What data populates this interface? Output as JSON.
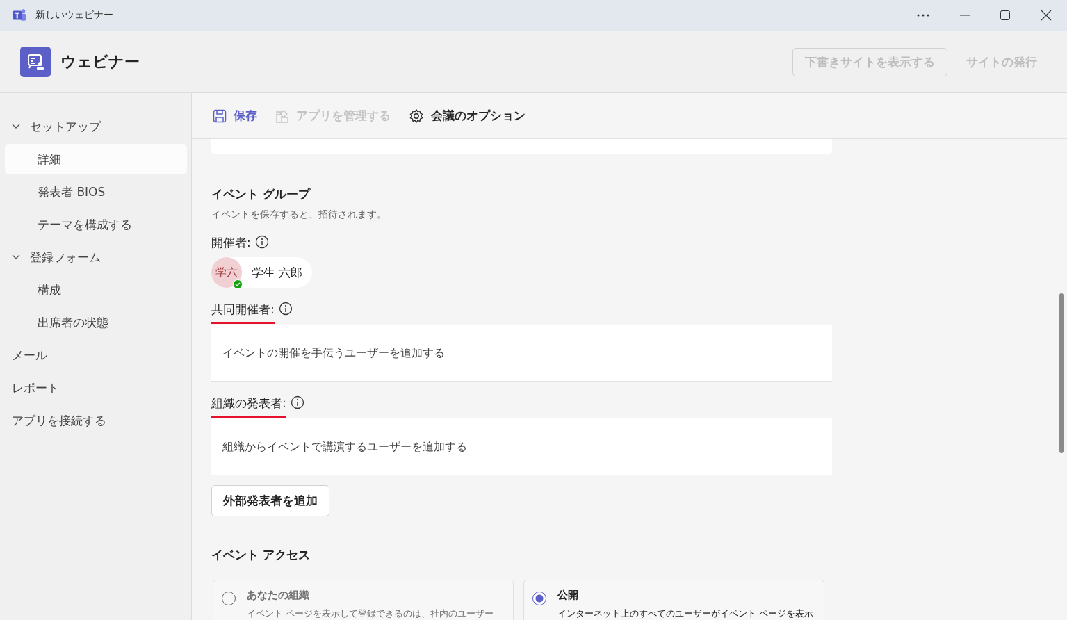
{
  "window": {
    "title": "新しいウェビナー"
  },
  "header": {
    "title": "ウェビナー",
    "buttons": [
      {
        "label": "下書きサイトを表示する",
        "kind": "outline",
        "disabled": true
      },
      {
        "label": "サイトの発行",
        "kind": "plain",
        "disabled": true
      }
    ]
  },
  "sidebar": {
    "items": [
      {
        "label": "セットアップ",
        "expanded": true,
        "selected": false,
        "children": [
          {
            "label": "詳細",
            "selected": true
          },
          {
            "label": "発表者 BIOS",
            "selected": false
          },
          {
            "label": "テーマを構成する",
            "selected": false
          }
        ]
      },
      {
        "label": "登録フォーム",
        "expanded": true,
        "selected": false,
        "children": [
          {
            "label": "構成",
            "selected": false
          },
          {
            "label": "出席者の状態",
            "selected": false
          }
        ]
      },
      {
        "label": "メール",
        "selected": false
      },
      {
        "label": "レポート",
        "selected": false
      },
      {
        "label": "アプリを接続する",
        "selected": false
      }
    ]
  },
  "toolbar": [
    {
      "label": "保存",
      "kind": "save",
      "disabled": false
    },
    {
      "label": "アプリを管理する",
      "kind": "apps",
      "disabled": true
    },
    {
      "label": "会議のオプション",
      "kind": "gear",
      "disabled": false
    }
  ],
  "event_group": {
    "title": "イベント グループ",
    "subtitle": "イベントを保存すると、招待されます。",
    "organizer": {
      "label": "開催者:",
      "underlined": false,
      "initials": "学六",
      "name": "学生 六郎",
      "online": true
    },
    "co_organizers": {
      "label": "共同開催者:",
      "underlined": true,
      "placeholder": "イベントの開催を手伝うユーザーを追加する"
    },
    "presenters": {
      "label": "組織の発表者:",
      "underlined": true,
      "placeholder": "組織からイベントで講演するユーザーを追加する"
    },
    "add_button": "外部発表者を追加"
  },
  "event_access": {
    "title": "イベント アクセス",
    "options": [
      {
        "label": "あなたの組織",
        "description": "イベント ページを表示して登録できるのは、社内のユーザー",
        "selected": false
      },
      {
        "label": "公開",
        "description": "インターネット上のすべてのユーザーがイベント ページを表示",
        "selected": true
      }
    ]
  }
}
